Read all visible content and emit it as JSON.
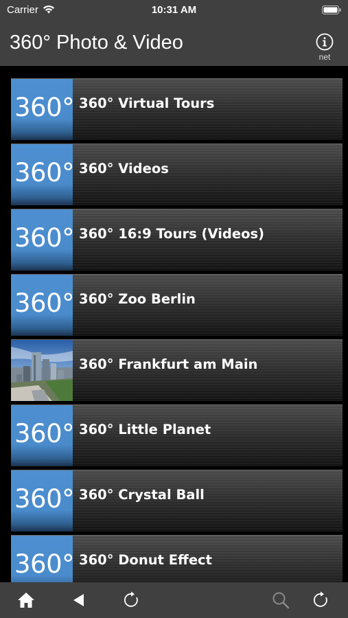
{
  "status_bar": {
    "carrier": "Carrier",
    "time": "10:31 AM"
  },
  "header": {
    "title": "360° Photo & Video",
    "info_label": "net"
  },
  "list": {
    "thumb_text": "360°",
    "items": [
      {
        "label": "360° Virtual Tours",
        "thumb": "360-badge"
      },
      {
        "label": "360° Videos",
        "thumb": "360-badge"
      },
      {
        "label": "360° 16:9 Tours (Videos)",
        "thumb": "360-badge"
      },
      {
        "label": "360° Zoo Berlin",
        "thumb": "360-badge"
      },
      {
        "label": "360° Frankfurt am Main",
        "thumb": "city-photo"
      },
      {
        "label": "360° Little Planet",
        "thumb": "360-badge"
      },
      {
        "label": "360° Crystal Ball",
        "thumb": "360-badge"
      },
      {
        "label": "360° Donut Effect",
        "thumb": "360-badge"
      }
    ]
  },
  "toolbar": {
    "icons": [
      "home-icon",
      "back-icon",
      "reload-icon",
      "search-icon",
      "refresh-icon"
    ]
  },
  "colors": {
    "bar_background": "#404040",
    "thumb_blue": "#4a8bcc",
    "list_background": "#000000"
  }
}
